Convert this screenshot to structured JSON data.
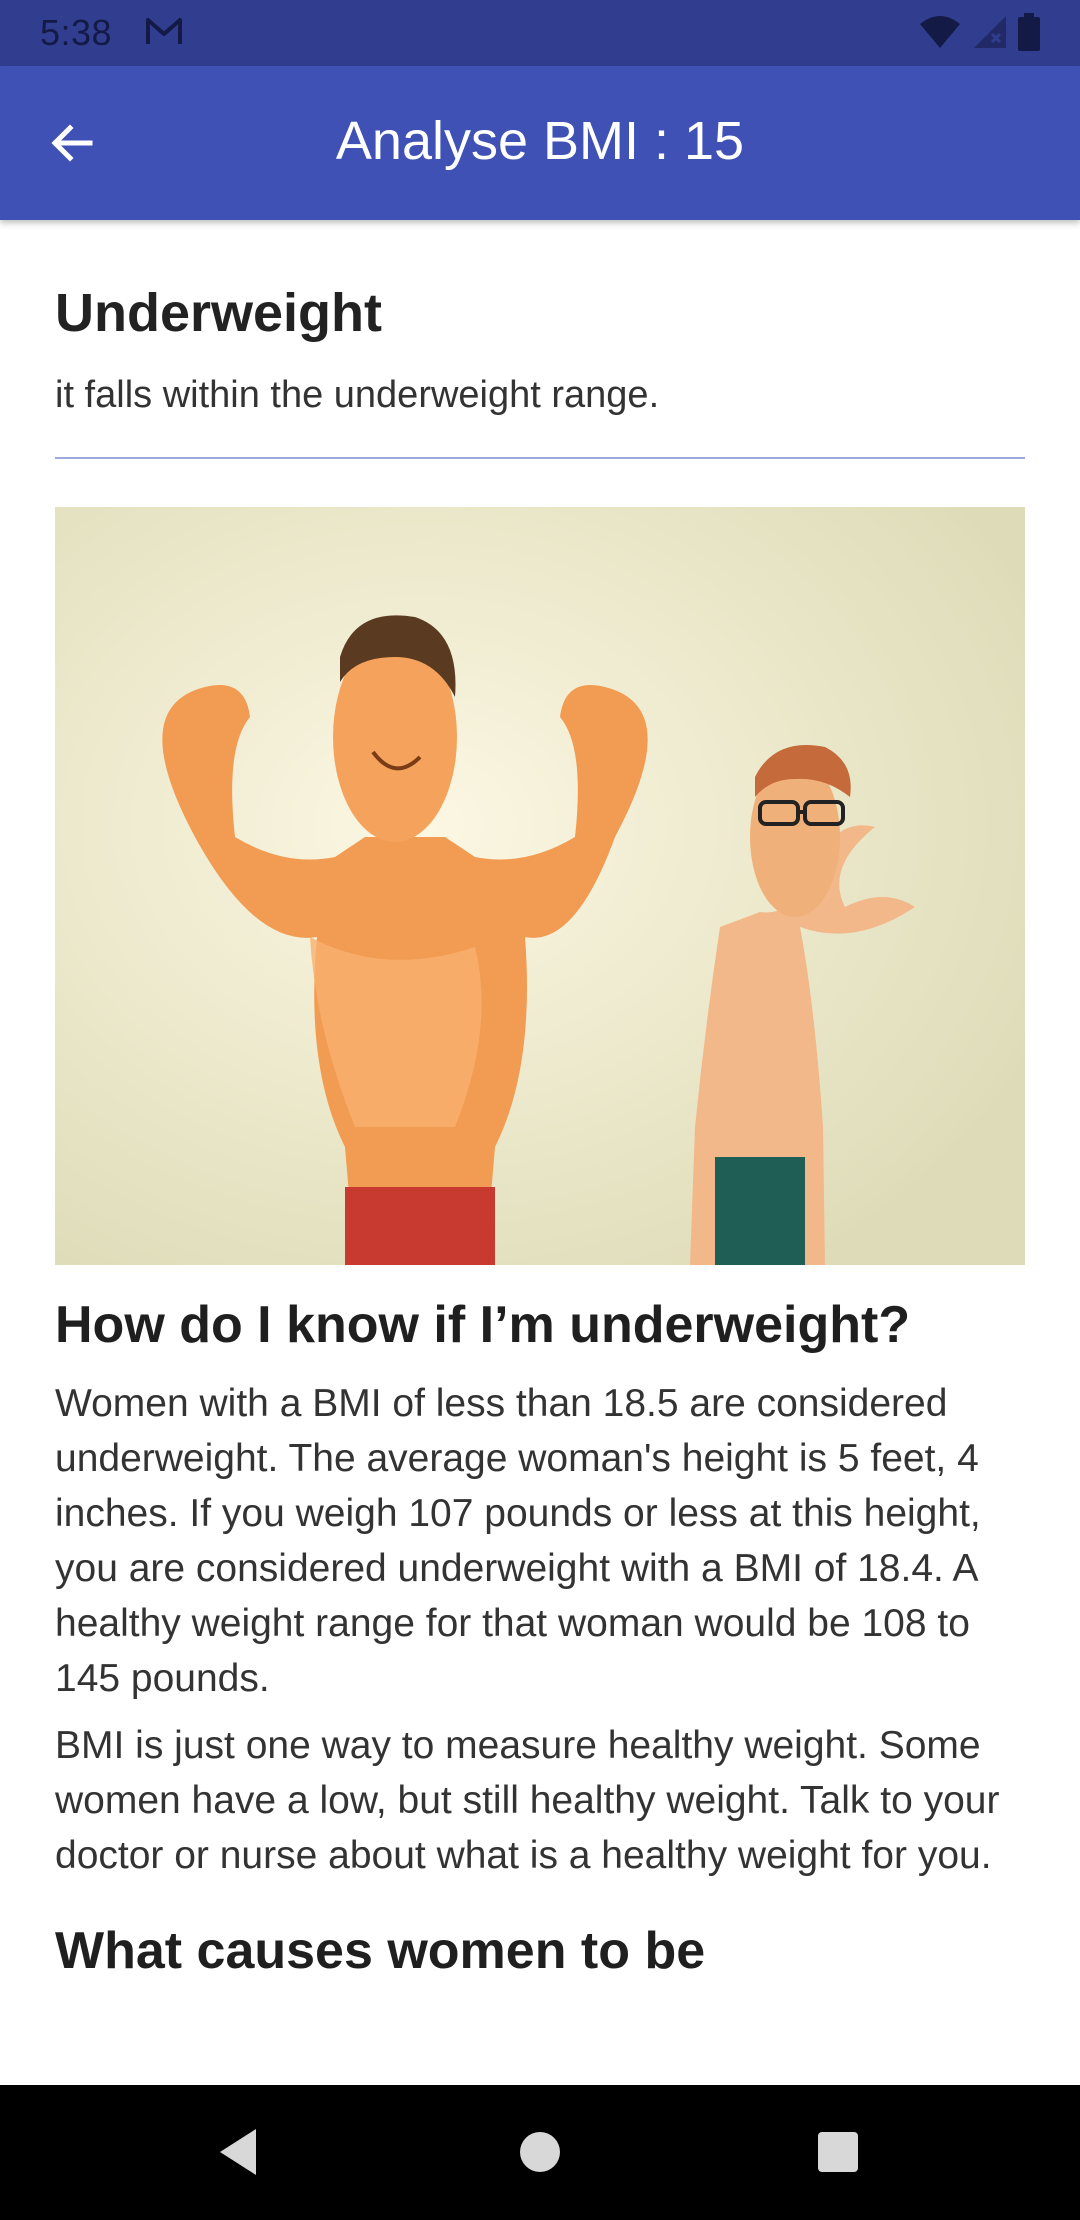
{
  "status_bar": {
    "time": "5:38",
    "icons": [
      "gmail-icon",
      "wifi-icon",
      "signal-icon",
      "battery-icon"
    ]
  },
  "app_bar": {
    "title": "Analyse BMI : 15",
    "back_icon": "arrow-back-icon",
    "background_color": "#3f51b5"
  },
  "result": {
    "title": "Underweight",
    "description": "it falls within the underweight range."
  },
  "illustration": {
    "icon": "muscular-vs-skinny-man-illustration"
  },
  "sections": [
    {
      "heading": "How do I know if I’m underweight?",
      "paragraphs": [
        "Women with a BMI of less than 18.5 are considered underweight. The average woman's height is 5 feet, 4 inches. If you weigh 107 pounds or less at this height, you are considered underweight with a BMI of 18.4. A healthy weight range for that woman would be 108 to 145 pounds.",
        "BMI is just one way to measure healthy weight. Some women have a low, but still healthy weight. Talk to your doctor or nurse about what is a healthy weight for you."
      ]
    },
    {
      "heading": "What causes women to be"
    }
  ],
  "nav_bar": {
    "icons": [
      "nav-back-icon",
      "nav-home-icon",
      "nav-recents-icon"
    ]
  }
}
